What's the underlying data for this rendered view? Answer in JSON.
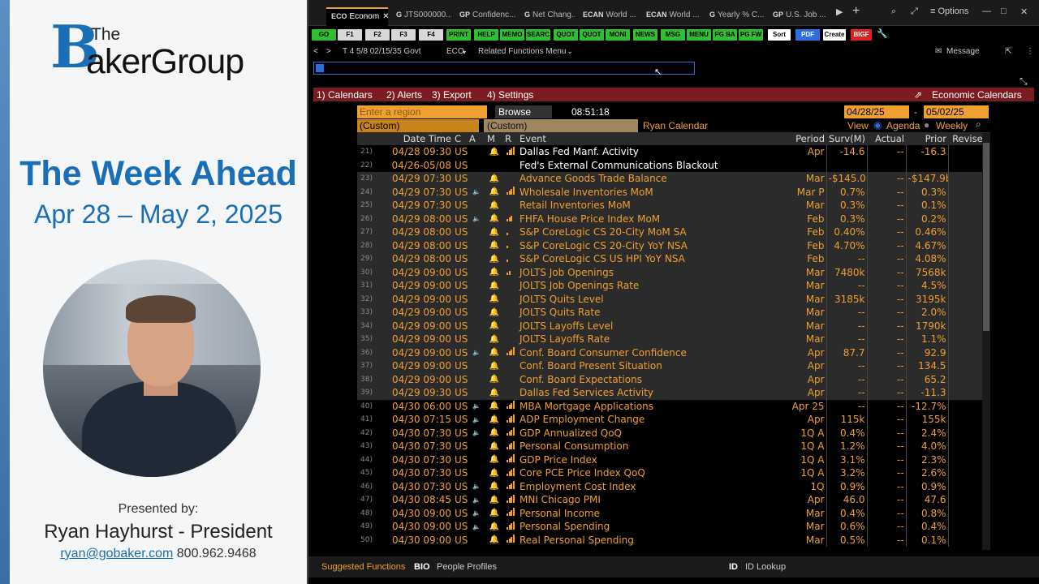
{
  "left": {
    "logo_the": "The",
    "logo_b": "B",
    "logo_rest": "akerGroup",
    "title": "The Week Ahead",
    "dates": "Apr 28 – May 2, 2025",
    "presented_by": "Presented by:",
    "name": "Ryan Hayhurst - President",
    "email": "ryan@gobaker.com",
    "phone": "800.962.9468"
  },
  "tabs": [
    {
      "code": "ECO",
      "label": "Econom"
    },
    {
      "code": "G",
      "label": "JTS000000..."
    },
    {
      "code": "GP",
      "label": "Confidenc..."
    },
    {
      "code": "G",
      "label": "Net Chang..."
    },
    {
      "code": "ECAN",
      "label": "World ..."
    },
    {
      "code": "ECAN",
      "label": "World ..."
    },
    {
      "code": "G",
      "label": "Yearly % C..."
    },
    {
      "code": "GP",
      "label": "U.S. Job ..."
    }
  ],
  "window_options": "Options",
  "fkeys": [
    "GO",
    "F1",
    "F2",
    "F3",
    "F4",
    "PRINT",
    "HELP",
    "MEMO",
    "SEARC",
    "QUOT",
    "QUOT",
    "MONI",
    "NEWS",
    "MSG",
    "MENU",
    "PG BA",
    "PG FW",
    "Sort",
    "PDF",
    "Create",
    "BIGF"
  ],
  "bar2": {
    "security": "T 4 5/8 02/15/35 Govt",
    "mnemonic": "ECO",
    "related": "Related Functions Menu",
    "message": "Message"
  },
  "menu": {
    "calendars": "1) Calendars",
    "alerts": "2) Alerts",
    "export": "3) Export",
    "settings": "4) Settings",
    "right": "Economic Calendars"
  },
  "controls": {
    "region_placeholder": "Enter a region",
    "browse": "Browse",
    "time": "08:51:18",
    "start_date": "04/28/25",
    "end_date": "05/02/25",
    "custom1": "(Custom)",
    "custom2": "(Custom)",
    "calendar_name": "Ryan Calendar",
    "view": "View",
    "agenda": "Agenda",
    "weekly": "Weekly"
  },
  "headers": [
    "",
    "Date Time",
    "C",
    "A",
    "M",
    "R",
    "Event",
    "Period",
    "Surv(M)",
    "Actual",
    "Prior",
    "Revised"
  ],
  "rows": [
    {
      "n": "21)",
      "dt": "04/28 09:30",
      "c": "US",
      "a": false,
      "r": 4,
      "ev": "Dallas Fed Manf. Activity",
      "p": "Apr",
      "s": "-14.6",
      "act": "--",
      "pr": "-16.3",
      "rev": "--",
      "cls": "hl"
    },
    {
      "n": "22)",
      "dt": "04/26-05/08",
      "c": "US",
      "a": false,
      "r": 0,
      "ev": "Fed's External Communications Blackout",
      "p": "",
      "s": "",
      "act": "",
      "pr": "",
      "rev": "",
      "cls": "hl"
    },
    {
      "n": "23)",
      "dt": "04/29 07:30",
      "c": "US",
      "a": false,
      "r": 0,
      "ev": "Advance Goods Trade Balance",
      "p": "Mar",
      "s": "-$145.0b",
      "act": "--",
      "pr": "-$147.9b",
      "rev": "--",
      "cls": "dim"
    },
    {
      "n": "24)",
      "dt": "04/29 07:30",
      "c": "US",
      "a": true,
      "r": 4,
      "ev": "Wholesale Inventories MoM",
      "p": "Mar P",
      "s": "0.7%",
      "act": "--",
      "pr": "0.3%",
      "rev": "--",
      "cls": "dim"
    },
    {
      "n": "25)",
      "dt": "04/29 07:30",
      "c": "US",
      "a": false,
      "r": 0,
      "ev": "Retail Inventories MoM",
      "p": "Mar",
      "s": "0.3%",
      "act": "--",
      "pr": "0.1%",
      "rev": "--",
      "cls": "dim"
    },
    {
      "n": "26)",
      "dt": "04/29 08:00",
      "c": "US",
      "a": true,
      "r": 3,
      "ev": "FHFA House Price Index MoM",
      "p": "Feb",
      "s": "0.3%",
      "act": "--",
      "pr": "0.2%",
      "rev": "--",
      "cls": "dim"
    },
    {
      "n": "27)",
      "dt": "04/29 08:00",
      "c": "US",
      "a": false,
      "r": 1,
      "ev": "S&P CoreLogic CS 20-City MoM SA",
      "p": "Feb",
      "s": "0.40%",
      "act": "--",
      "pr": "0.46%",
      "rev": "--",
      "cls": "dim"
    },
    {
      "n": "28)",
      "dt": "04/29 08:00",
      "c": "US",
      "a": false,
      "r": 1,
      "ev": "S&P CoreLogic CS 20-City YoY NSA",
      "p": "Feb",
      "s": "4.70%",
      "act": "--",
      "pr": "4.67%",
      "rev": "--",
      "cls": "dim"
    },
    {
      "n": "29)",
      "dt": "04/29 08:00",
      "c": "US",
      "a": false,
      "r": 1,
      "ev": "S&P CoreLogic CS US HPI YoY NSA",
      "p": "Feb",
      "s": "--",
      "act": "--",
      "pr": "4.08%",
      "rev": "--",
      "cls": "dim"
    },
    {
      "n": "30)",
      "dt": "04/29 09:00",
      "c": "US",
      "a": false,
      "r": 2,
      "ev": "JOLTS Job Openings",
      "p": "Mar",
      "s": "7480k",
      "act": "--",
      "pr": "7568k",
      "rev": "--",
      "cls": "dim"
    },
    {
      "n": "31)",
      "dt": "04/29 09:00",
      "c": "US",
      "a": false,
      "r": 0,
      "ev": "JOLTS Job Openings Rate",
      "p": "Mar",
      "s": "--",
      "act": "--",
      "pr": "4.5%",
      "rev": "--",
      "cls": "dim"
    },
    {
      "n": "32)",
      "dt": "04/29 09:00",
      "c": "US",
      "a": false,
      "r": 0,
      "ev": "JOLTS Quits Level",
      "p": "Mar",
      "s": "3185k",
      "act": "--",
      "pr": "3195k",
      "rev": "--",
      "cls": "dim"
    },
    {
      "n": "33)",
      "dt": "04/29 09:00",
      "c": "US",
      "a": false,
      "r": 0,
      "ev": "JOLTS Quits Rate",
      "p": "Mar",
      "s": "--",
      "act": "--",
      "pr": "2.0%",
      "rev": "--",
      "cls": "dim"
    },
    {
      "n": "34)",
      "dt": "04/29 09:00",
      "c": "US",
      "a": false,
      "r": 0,
      "ev": "JOLTS Layoffs Level",
      "p": "Mar",
      "s": "--",
      "act": "--",
      "pr": "1790k",
      "rev": "--",
      "cls": "dim"
    },
    {
      "n": "35)",
      "dt": "04/29 09:00",
      "c": "US",
      "a": false,
      "r": 0,
      "ev": "JOLTS Layoffs Rate",
      "p": "Mar",
      "s": "--",
      "act": "--",
      "pr": "1.1%",
      "rev": "--",
      "cls": "dim"
    },
    {
      "n": "36)",
      "dt": "04/29 09:00",
      "c": "US",
      "a": true,
      "r": 4,
      "ev": "Conf. Board Consumer Confidence",
      "p": "Apr",
      "s": "87.7",
      "act": "--",
      "pr": "92.9",
      "rev": "--",
      "cls": "dim"
    },
    {
      "n": "37)",
      "dt": "04/29 09:00",
      "c": "US",
      "a": false,
      "r": 0,
      "ev": "Conf. Board Present Situation",
      "p": "Apr",
      "s": "--",
      "act": "--",
      "pr": "134.5",
      "rev": "--",
      "cls": "dim"
    },
    {
      "n": "38)",
      "dt": "04/29 09:00",
      "c": "US",
      "a": false,
      "r": 0,
      "ev": "Conf. Board Expectations",
      "p": "Apr",
      "s": "--",
      "act": "--",
      "pr": "65.2",
      "rev": "--",
      "cls": "dim"
    },
    {
      "n": "39)",
      "dt": "04/29 09:30",
      "c": "US",
      "a": false,
      "r": 0,
      "ev": "Dallas Fed Services Activity",
      "p": "Apr",
      "s": "--",
      "act": "--",
      "pr": "-11.3",
      "rev": "--",
      "cls": "dim"
    },
    {
      "n": "40)",
      "dt": "04/30 06:00",
      "c": "US",
      "a": true,
      "r": 4,
      "ev": "MBA Mortgage Applications",
      "p": "Apr 25",
      "s": "--",
      "act": "--",
      "pr": "-12.7%",
      "rev": "--",
      "cls": ""
    },
    {
      "n": "41)",
      "dt": "04/30 07:15",
      "c": "US",
      "a": true,
      "r": 4,
      "ev": "ADP Employment Change",
      "p": "Apr",
      "s": "115k",
      "act": "--",
      "pr": "155k",
      "rev": "--",
      "cls": ""
    },
    {
      "n": "42)",
      "dt": "04/30 07:30",
      "c": "US",
      "a": true,
      "r": 4,
      "ev": "GDP Annualized QoQ",
      "p": "1Q A",
      "s": "0.4%",
      "act": "--",
      "pr": "2.4%",
      "rev": "--",
      "cls": ""
    },
    {
      "n": "43)",
      "dt": "04/30 07:30",
      "c": "US",
      "a": false,
      "r": 4,
      "ev": "Personal Consumption",
      "p": "1Q A",
      "s": "1.2%",
      "act": "--",
      "pr": "4.0%",
      "rev": "--",
      "cls": ""
    },
    {
      "n": "44)",
      "dt": "04/30 07:30",
      "c": "US",
      "a": false,
      "r": 4,
      "ev": "GDP Price Index",
      "p": "1Q A",
      "s": "3.1%",
      "act": "--",
      "pr": "2.3%",
      "rev": "--",
      "cls": ""
    },
    {
      "n": "45)",
      "dt": "04/30 07:30",
      "c": "US",
      "a": false,
      "r": 4,
      "ev": "Core PCE Price Index QoQ",
      "p": "1Q A",
      "s": "3.2%",
      "act": "--",
      "pr": "2.6%",
      "rev": "--",
      "cls": ""
    },
    {
      "n": "46)",
      "dt": "04/30 07:30",
      "c": "US",
      "a": true,
      "r": 4,
      "ev": "Employment Cost Index",
      "p": "1Q",
      "s": "0.9%",
      "act": "--",
      "pr": "0.9%",
      "rev": "--",
      "cls": ""
    },
    {
      "n": "47)",
      "dt": "04/30 08:45",
      "c": "US",
      "a": true,
      "r": 4,
      "ev": "MNI Chicago PMI",
      "p": "Apr",
      "s": "46.0",
      "act": "--",
      "pr": "47.6",
      "rev": "--",
      "cls": ""
    },
    {
      "n": "48)",
      "dt": "04/30 09:00",
      "c": "US",
      "a": true,
      "r": 4,
      "ev": "Personal Income",
      "p": "Mar",
      "s": "0.4%",
      "act": "--",
      "pr": "0.8%",
      "rev": "--",
      "cls": ""
    },
    {
      "n": "49)",
      "dt": "04/30 09:00",
      "c": "US",
      "a": true,
      "r": 4,
      "ev": "Personal Spending",
      "p": "Mar",
      "s": "0.6%",
      "act": "--",
      "pr": "0.4%",
      "rev": "--",
      "cls": ""
    },
    {
      "n": "50)",
      "dt": "04/30 09:00",
      "c": "US",
      "a": false,
      "r": 4,
      "ev": "Real Personal Spending",
      "p": "Mar",
      "s": "0.5%",
      "act": "--",
      "pr": "0.1%",
      "rev": "--",
      "cls": ""
    }
  ],
  "footer": {
    "suggested": "Suggested Functions",
    "bio_code": "BIO",
    "bio": "People Profiles",
    "id_code": "ID",
    "id": "ID Lookup"
  }
}
